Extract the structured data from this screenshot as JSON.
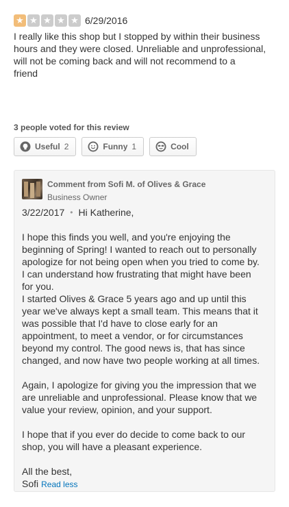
{
  "review": {
    "rating": 1,
    "max_rating": 5,
    "star_color": "#f2bd79",
    "empty_star_color": "#cccccc",
    "date": "6/29/2016",
    "lines": [
      "I really like this shop but I stopped by within their business",
      "hours and they were closed. Unreliable and unprofessional,",
      "will not be coming back and will not recommend to a",
      "friend"
    ]
  },
  "votes": {
    "label": "3 people voted for this review",
    "useful": {
      "label": "Useful",
      "count": "2",
      "icon": "lightbulb-icon"
    },
    "funny": {
      "label": "Funny",
      "count": "1",
      "icon": "smile-icon"
    },
    "cool": {
      "label": "Cool",
      "count": "",
      "icon": "sunglasses-icon"
    }
  },
  "comment": {
    "title": "Comment from Sofi M. of Olives & Grace",
    "role": "Business Owner",
    "date": "3/22/2017",
    "greeting": "Hi Katherine,",
    "para1": [
      "I hope this finds you well, and you're enjoying the",
      "beginning of Spring!  I wanted to reach out to personally",
      "apologize for not being open when you tried to come by.",
      "I can understand how frustrating that might have been",
      "for you.",
      "I started Olives & Grace 5 years ago and up until this",
      "year we've always kept a small team.  This means that it",
      "was possible that I'd have to close early for an",
      "appointment, to meet a vendor, or for circumstances",
      "beyond my control. The good news is, that has since",
      "changed, and now have two people working at all times."
    ],
    "para2": [
      "Again, I apologize for giving you the impression that we",
      "are unreliable and unprofessional.  Please know that we",
      "value your review, opinion, and your support."
    ],
    "para3": [
      "I hope that if you ever do decide to come back to our",
      "shop, you will have a pleasant experience."
    ],
    "closing": "All the best,",
    "signature": "Sofi",
    "read_less": "Read less"
  }
}
